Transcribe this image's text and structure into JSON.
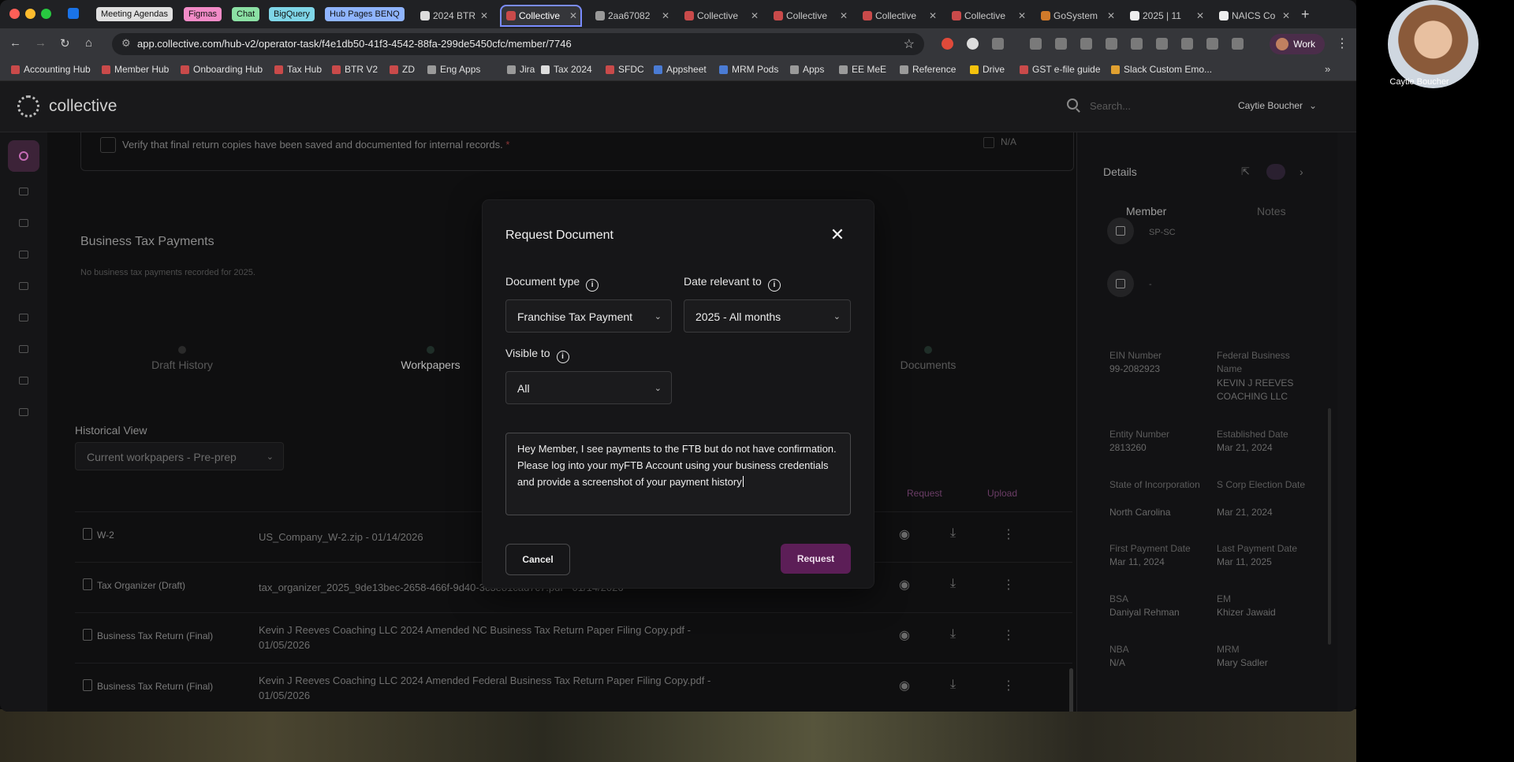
{
  "browser": {
    "tab_groups": [
      {
        "label": "Meeting Agendas",
        "color": "#e0e0e0"
      },
      {
        "label": "Figmas",
        "color": "#f28bc7"
      },
      {
        "label": "Chat",
        "color": "#8be0a4"
      },
      {
        "label": "BigQuery",
        "color": "#7fd6e8"
      },
      {
        "label": "Hub Pages BENQ",
        "color": "#8fb4ff"
      }
    ],
    "tabs": [
      {
        "title": "2024 BTR",
        "active": false
      },
      {
        "title": "Collective",
        "active": true
      },
      {
        "title": "2aa67082",
        "active": false
      },
      {
        "title": "Collective",
        "active": false
      },
      {
        "title": "Collective",
        "active": false
      },
      {
        "title": "Collective",
        "active": false
      },
      {
        "title": "Collective",
        "active": false
      },
      {
        "title": "GoSystem",
        "active": false
      },
      {
        "title": "2025 | 11",
        "active": false
      },
      {
        "title": "NAICS Co",
        "active": false
      }
    ],
    "url": "app.collective.com/hub-v2/operator-task/f4e1db50-41f3-4542-88fa-299de5450cfc/member/7746",
    "profile_label": "Work",
    "bookmarks": [
      {
        "label": "Accounting Hub",
        "color": "#c94a4a"
      },
      {
        "label": "Member Hub",
        "color": "#c94a4a"
      },
      {
        "label": "Onboarding Hub",
        "color": "#c94a4a"
      },
      {
        "label": "Tax Hub",
        "color": "#c94a4a"
      },
      {
        "label": "BTR V2",
        "color": "#c94a4a"
      },
      {
        "label": "ZD",
        "color": "#c94a4a"
      },
      {
        "label": "Eng Apps",
        "color": "#9a9a9a"
      },
      {
        "label": "Jira",
        "color": "#9a9a9a"
      },
      {
        "label": "Tax 2024",
        "color": "#dddddd"
      },
      {
        "label": "SFDC",
        "color": "#c94a4a"
      },
      {
        "label": "Appsheet",
        "color": "#4a7bd4"
      },
      {
        "label": "MRM Pods",
        "color": "#4a7bd4"
      },
      {
        "label": "Apps",
        "color": "#9a9a9a"
      },
      {
        "label": "EE MeE",
        "color": "#9a9a9a"
      },
      {
        "label": "Reference",
        "color": "#9a9a9a"
      },
      {
        "label": "Drive",
        "color": "#f4c20d"
      },
      {
        "label": "GST e-file guide",
        "color": "#c94a4a"
      },
      {
        "label": "Slack Custom Emo...",
        "color": "#e0a030"
      }
    ]
  },
  "webcam": {
    "name": "Caytie Boucher"
  },
  "app": {
    "logo": "collective",
    "search_placeholder": "Search...",
    "user_name": "Caytie Boucher"
  },
  "main": {
    "verify_text": "Verify that final return copies have been saved and documented for internal records.",
    "required_mark": "*",
    "na_label": "N/A",
    "section_title": "Business Tax Payments",
    "empty_note": "No business tax payments recorded for 2025.",
    "subtabs": [
      "Draft History",
      "Workpapers",
      "Documents"
    ],
    "historical_label": "Historical View",
    "historical_value": "Current workpapers - Pre-prep",
    "col_request": "Request",
    "col_upload": "Upload",
    "documents": [
      {
        "type": "W-2",
        "file": "US_Company_W-2.zip - 01/14/2026"
      },
      {
        "type": "Tax Organizer (Draft)",
        "file": "tax_organizer_2025_9de13bec-2658-466f-9d40-3c3e81cad7c7.pdf - 01/14/2026"
      },
      {
        "type": "Business Tax Return (Final)",
        "file": "Kevin J Reeves Coaching LLC 2024 Amended NC Business Tax Return Paper Filing Copy.pdf - 01/05/2026"
      },
      {
        "type": "Business Tax Return (Final)",
        "file": "Kevin J Reeves Coaching LLC 2024 Amended Federal Business Tax Return Paper Filing Copy.pdf - 01/05/2026"
      }
    ]
  },
  "details": {
    "title": "Details",
    "tabs": [
      "Member",
      "Notes"
    ],
    "entity_code": "SP-SC",
    "flag_value": "-",
    "fields": [
      {
        "label": "EIN Number",
        "value": "99-2082923"
      },
      {
        "label": "Federal Business Name",
        "value": "KEVIN J REEVES COACHING LLC"
      },
      {
        "label": "Entity Number",
        "value": "2813260"
      },
      {
        "label": "Established Date",
        "value": "Mar 21, 2024"
      },
      {
        "label": "State of Incorporation",
        "value": "North Carolina"
      },
      {
        "label": "S Corp Election Date",
        "value": "Mar 21, 2024"
      },
      {
        "label": "First Payment Date",
        "value": "Mar 11, 2024"
      },
      {
        "label": "Last Payment Date",
        "value": "Mar 11, 2025"
      },
      {
        "label": "BSA",
        "value": "Daniyal Rehman"
      },
      {
        "label": "EM",
        "value": "Khizer Jawaid"
      },
      {
        "label": "NBA",
        "value": "N/A"
      },
      {
        "label": "MRM",
        "value": "Mary Sadler"
      }
    ]
  },
  "modal": {
    "title": "Request Document",
    "document_type_label": "Document type",
    "document_type_value": "Franchise Tax Payment",
    "date_label": "Date relevant to",
    "date_value": "2025 - All months",
    "visible_label": "Visible to",
    "visible_value": "All",
    "message": "Hey Member, I see payments to the FTB but do not have confirmation. Please log into your myFTB Account using your business credentials and provide a screenshot of your payment history",
    "cancel_label": "Cancel",
    "request_label": "Request",
    "accent_color": "#5c1e57"
  }
}
